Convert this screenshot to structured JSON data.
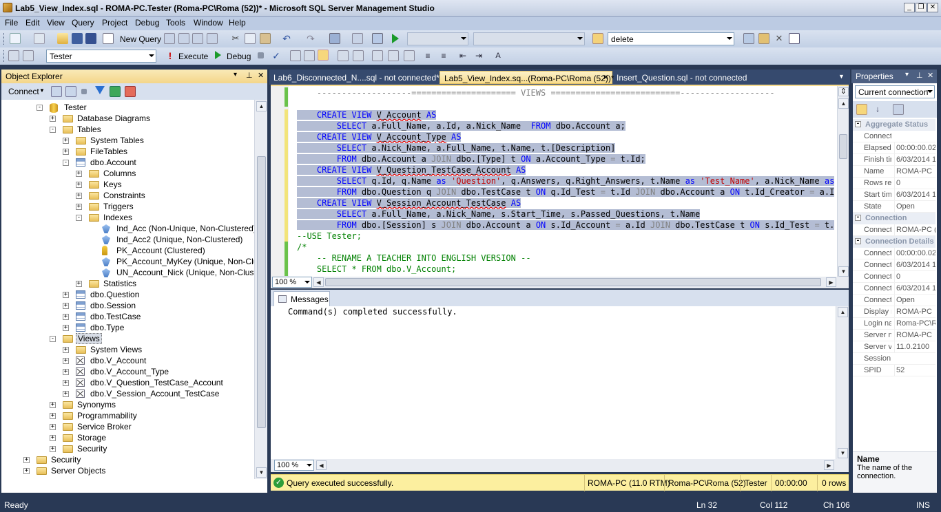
{
  "window": {
    "title": "Lab5_View_Index.sql - ROMA-PC.Tester (Roma-PC\\Roma (52))* - Microsoft SQL Server Management Studio"
  },
  "menu": [
    "File",
    "Edit",
    "View",
    "Query",
    "Project",
    "Debug",
    "Tools",
    "Window",
    "Help"
  ],
  "toolbar1": {
    "new_query": "New Query",
    "find_value": "delete"
  },
  "toolbar2": {
    "database": "Tester",
    "execute": "Execute",
    "debug": "Debug"
  },
  "object_explorer": {
    "title": "Object Explorer",
    "connect": "Connect",
    "tree": [
      {
        "label": "Tester",
        "level": 2,
        "exp": "-",
        "icon": "db"
      },
      {
        "label": "Database Diagrams",
        "level": 3,
        "exp": "+",
        "icon": "folder"
      },
      {
        "label": "Tables",
        "level": 3,
        "exp": "-",
        "icon": "folder"
      },
      {
        "label": "System Tables",
        "level": 4,
        "exp": "+",
        "icon": "folder"
      },
      {
        "label": "FileTables",
        "level": 4,
        "exp": "+",
        "icon": "folder"
      },
      {
        "label": "dbo.Account",
        "level": 4,
        "exp": "-",
        "icon": "table"
      },
      {
        "label": "Columns",
        "level": 5,
        "exp": "+",
        "icon": "folder"
      },
      {
        "label": "Keys",
        "level": 5,
        "exp": "+",
        "icon": "folder"
      },
      {
        "label": "Constraints",
        "level": 5,
        "exp": "+",
        "icon": "folder"
      },
      {
        "label": "Triggers",
        "level": 5,
        "exp": "+",
        "icon": "folder"
      },
      {
        "label": "Indexes",
        "level": 5,
        "exp": "-",
        "icon": "folder"
      },
      {
        "label": "Ind_Acc (Non-Unique, Non-Clustered)",
        "level": 6,
        "exp": "",
        "icon": "index"
      },
      {
        "label": "Ind_Acc2 (Unique, Non-Clustered)",
        "level": 6,
        "exp": "",
        "icon": "index"
      },
      {
        "label": "PK_Account (Clustered)",
        "level": 6,
        "exp": "",
        "icon": "key"
      },
      {
        "label": "PK_Account_MyKey (Unique, Non-Clustere",
        "level": 6,
        "exp": "",
        "icon": "index"
      },
      {
        "label": "UN_Account_Nick (Unique, Non-Clustered)",
        "level": 6,
        "exp": "",
        "icon": "index"
      },
      {
        "label": "Statistics",
        "level": 5,
        "exp": "+",
        "icon": "folder"
      },
      {
        "label": "dbo.Question",
        "level": 4,
        "exp": "+",
        "icon": "table"
      },
      {
        "label": "dbo.Session",
        "level": 4,
        "exp": "+",
        "icon": "table"
      },
      {
        "label": "dbo.TestCase",
        "level": 4,
        "exp": "+",
        "icon": "table"
      },
      {
        "label": "dbo.Type",
        "level": 4,
        "exp": "+",
        "icon": "table"
      },
      {
        "label": "Views",
        "level": 3,
        "exp": "-",
        "icon": "folder",
        "selected": true
      },
      {
        "label": "System Views",
        "level": 4,
        "exp": "+",
        "icon": "folder"
      },
      {
        "label": "dbo.V_Account",
        "level": 4,
        "exp": "+",
        "icon": "view"
      },
      {
        "label": "dbo.V_Account_Type",
        "level": 4,
        "exp": "+",
        "icon": "view"
      },
      {
        "label": "dbo.V_Question_TestCase_Account",
        "level": 4,
        "exp": "+",
        "icon": "view"
      },
      {
        "label": "dbo.V_Session_Account_TestCase",
        "level": 4,
        "exp": "+",
        "icon": "view"
      },
      {
        "label": "Synonyms",
        "level": 3,
        "exp": "+",
        "icon": "folder"
      },
      {
        "label": "Programmability",
        "level": 3,
        "exp": "+",
        "icon": "folder"
      },
      {
        "label": "Service Broker",
        "level": 3,
        "exp": "+",
        "icon": "folder"
      },
      {
        "label": "Storage",
        "level": 3,
        "exp": "+",
        "icon": "folder"
      },
      {
        "label": "Security",
        "level": 3,
        "exp": "+",
        "icon": "folder"
      },
      {
        "label": "Security",
        "level": 1,
        "exp": "+",
        "icon": "folder"
      },
      {
        "label": "Server Objects",
        "level": 1,
        "exp": "+",
        "icon": "folder"
      }
    ]
  },
  "tabs": [
    {
      "label": "Lab6_Disconnected_N....sql - not connected*",
      "active": false
    },
    {
      "label": "Lab5_View_Index.sq...(Roma-PC\\Roma (52))*",
      "active": true
    },
    {
      "label": "Insert_Question.sql - not connected",
      "active": false
    }
  ],
  "editor": {
    "zoom": "100 %",
    "lines": [
      "    -------------------===================== VIEWS ==========================-------------------",
      "",
      "    CREATE VIEW V_Account AS",
      "        SELECT a.Full_Name, a.Id, a.Nick_Name  FROM dbo.Account a;",
      "    CREATE VIEW V_Account_Type AS",
      "        SELECT a.Nick_Name, a.Full_Name, t.Name, t.[Description]",
      "        FROM dbo.Account a JOIN dbo.[Type] t ON a.Account_Type = t.Id;",
      "    CREATE VIEW V_Question_TestCase_Account AS",
      "        SELECT q.Id, q.Name as 'Question', q.Answers, q.Right_Answers, t.Name as 'Test_Name', a.Nick_Name as 'Cr",
      "        FROM dbo.Question q JOIN dbo.TestCase t ON q.Id_Test = t.Id JOIN dbo.Account a ON t.Id_Creator = a.Id;",
      "    CREATE VIEW V_Session_Account_TestCase AS",
      "        SELECT a.Full_Name, a.Nick_Name, s.Start_Time, s.Passed_Questions, t.Name",
      "        FROM dbo.[Session] s JOIN dbo.Account a ON s.Id_Account = a.Id JOIN dbo.TestCase t ON s.Id_Test = t.Id;",
      "--USE Tester;",
      "/*",
      "    -- RENAME A TEACHER INTO ENGLISH VERSION --",
      "    SELECT * FROM dbo.V_Account;"
    ]
  },
  "messages": {
    "tab": "Messages",
    "text": "Command(s) completed successfully.",
    "zoom": "100 %"
  },
  "query_status": {
    "message": "Query executed successfully.",
    "server": "ROMA-PC (11.0 RTM)",
    "user": "Roma-PC\\Roma (52)",
    "database": "Tester",
    "elapsed": "00:00:00",
    "rows": "0 rows"
  },
  "properties": {
    "title": "Properties",
    "object": "Current connection",
    "categories": [
      {
        "name": "Aggregate Status",
        "rows": [
          [
            "Connect",
            ""
          ],
          [
            "Elapsed",
            "00:00:00.02"
          ],
          [
            "Finish tim",
            "6/03/2014 1"
          ],
          [
            "Name",
            "ROMA-PC"
          ],
          [
            "Rows re",
            "0"
          ],
          [
            "Start tim",
            "6/03/2014 1"
          ],
          [
            "State",
            "Open"
          ]
        ]
      },
      {
        "name": "Connection",
        "rows": [
          [
            "Connect",
            "ROMA-PC (R"
          ]
        ]
      },
      {
        "name": "Connection Details",
        "rows": [
          [
            "Connect",
            "00:00:00.02"
          ],
          [
            "Connect",
            "6/03/2014 1"
          ],
          [
            "Connect",
            "0"
          ],
          [
            "Connect",
            "6/03/2014 1"
          ],
          [
            "Connect",
            "Open"
          ],
          [
            "Display r",
            "ROMA-PC"
          ],
          [
            "Login na",
            "Roma-PC\\Ro"
          ],
          [
            "Server n",
            "ROMA-PC"
          ],
          [
            "Server v",
            "11.0.2100"
          ],
          [
            "Session",
            ""
          ],
          [
            "SPID",
            "52"
          ]
        ]
      }
    ],
    "desc_title": "Name",
    "desc_text": "The name of the connection."
  },
  "status": {
    "ready": "Ready",
    "ln": "Ln 32",
    "col": "Col 112",
    "ch": "Ch 106",
    "ins": "INS"
  }
}
